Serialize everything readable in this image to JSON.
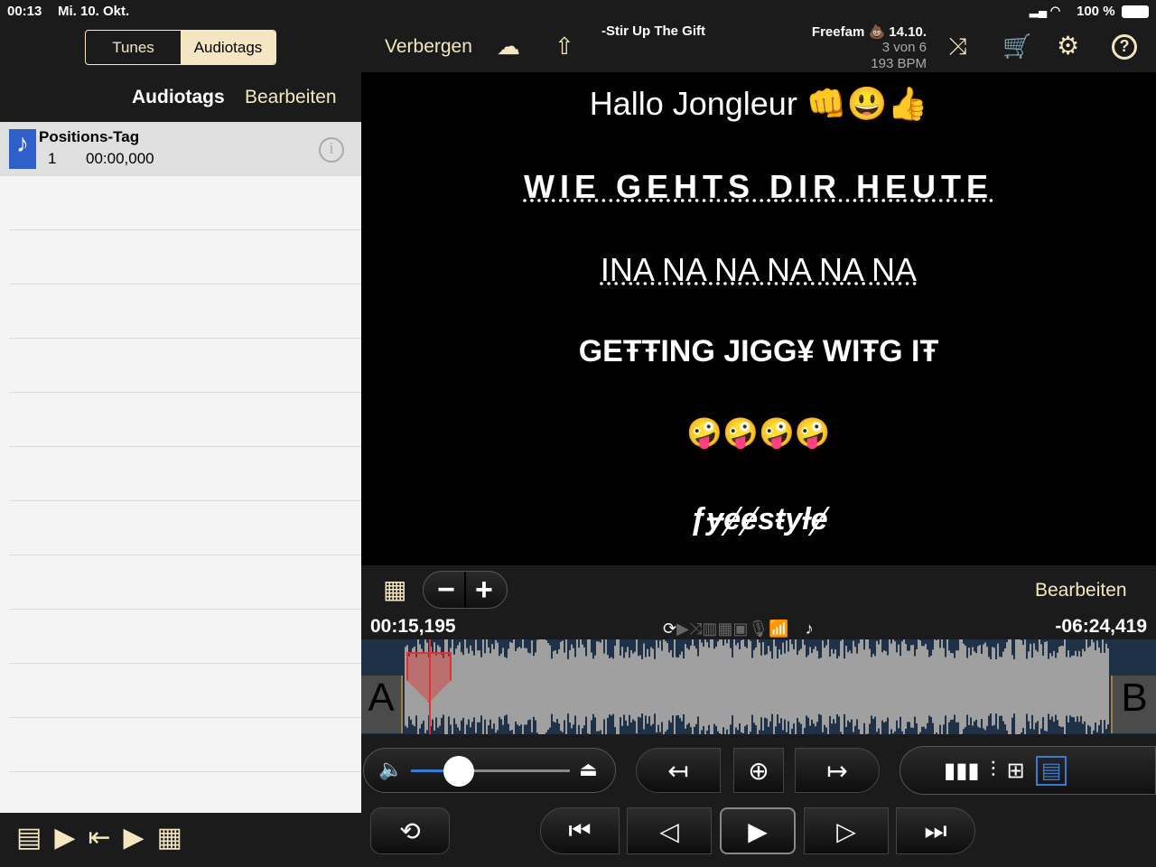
{
  "status": {
    "time": "00:13",
    "date": "Mi. 10. Okt.",
    "battery": "100 %"
  },
  "sidebar": {
    "tabs": [
      "Tunes",
      "Audiotags"
    ],
    "title": "Audiotags",
    "edit": "Bearbeiten",
    "items": [
      {
        "name": "Positions-Tag",
        "index": "1",
        "time": "00:00,000"
      }
    ]
  },
  "toolbar": {
    "hide": "Verbergen",
    "song_title": "-Stir Up The Gift",
    "artist": "Freefam 💩 14.10.",
    "position": "3 von 6",
    "bpm": "193 BPM"
  },
  "lyrics": [
    "Hallo Jongleur 👊😃👍",
    "WIE GEHTS DIR HEUTE",
    "INA NA NA NA NA NA",
    "GEŦŦING JIGG¥ WIŦG IŦ",
    "🤪🤪🤪🤪",
    "ƒɏɇɇsŧyƚɇ"
  ],
  "player": {
    "edit": "Bearbeiten",
    "elapsed": "00:15,195",
    "remaining": "-06:24,419",
    "marker_a": "A",
    "marker_b": "B",
    "volume": 0.3,
    "progress": 0.04
  },
  "colors": {
    "accent": "#f3e6c0",
    "wave_bg": "#1f3147",
    "volume": "#3a7bd5"
  }
}
